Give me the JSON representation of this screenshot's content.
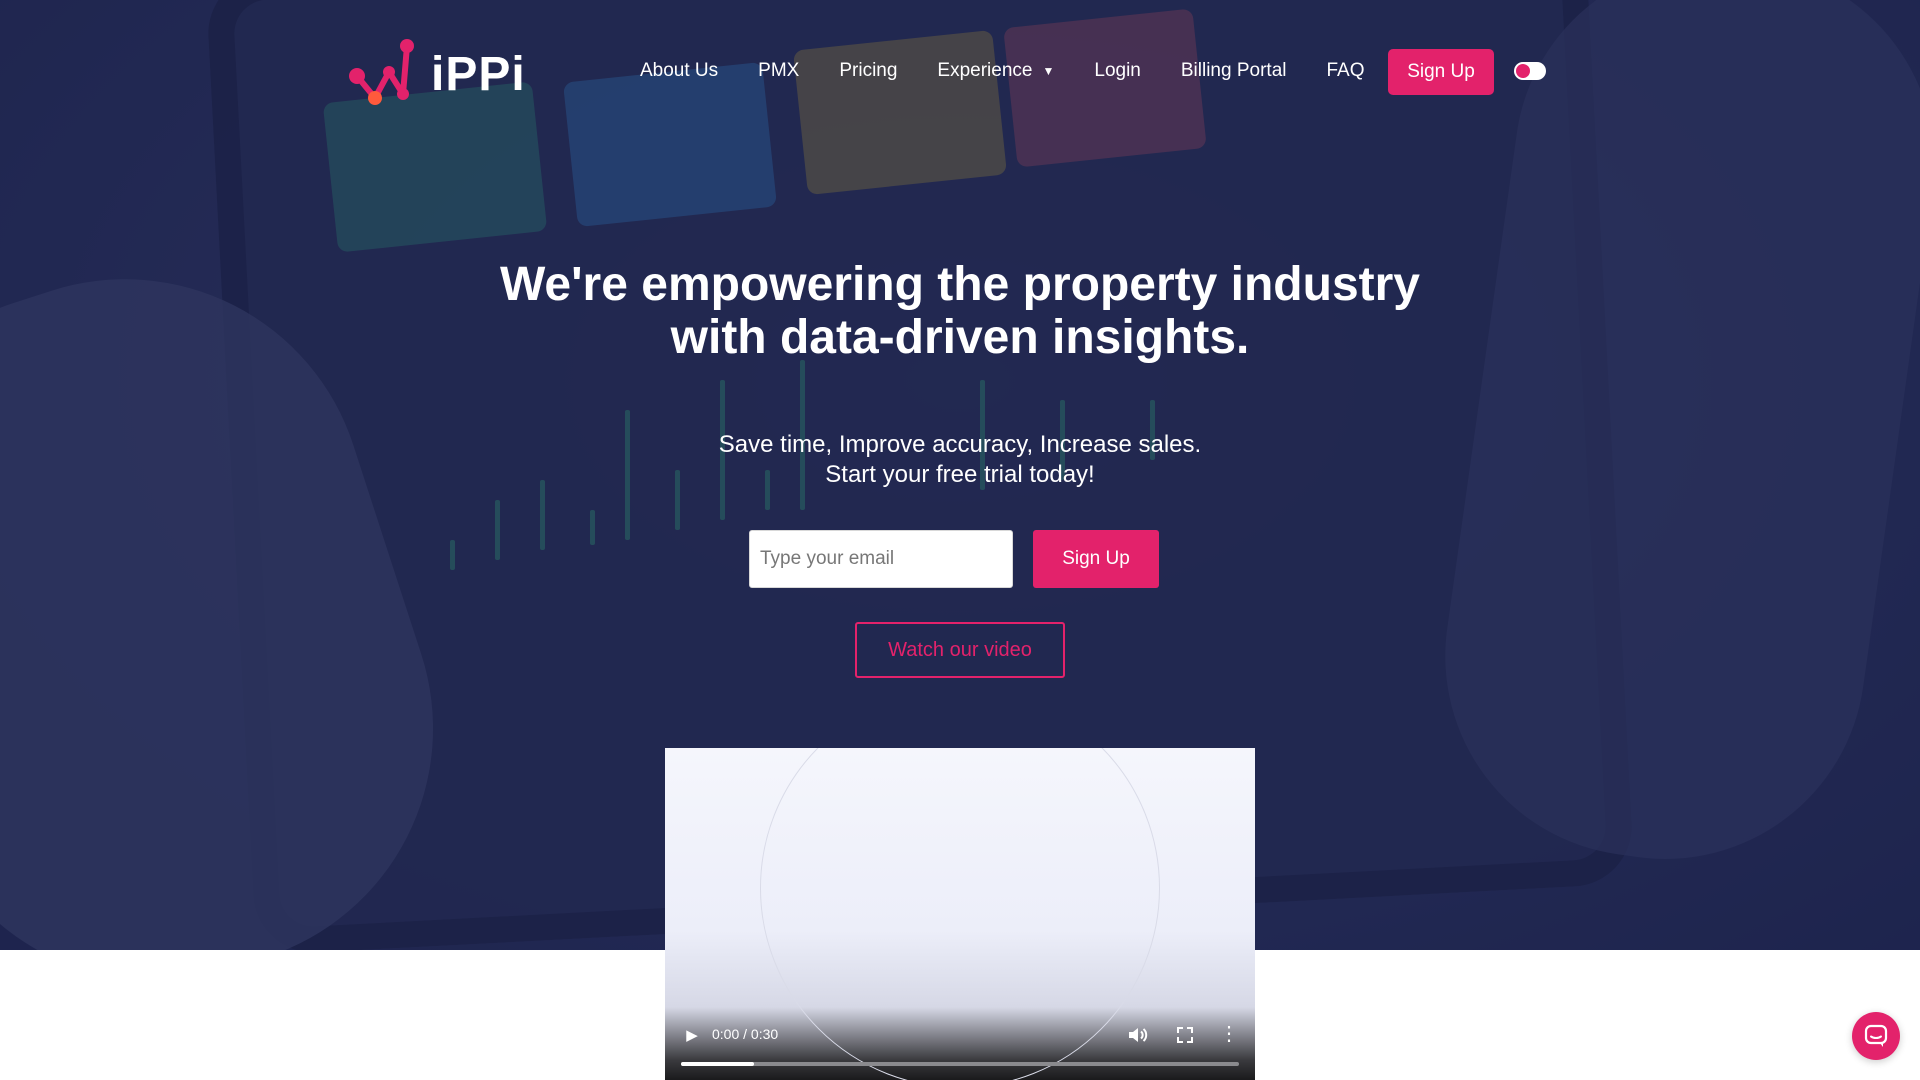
{
  "brand": {
    "name": "iPPi",
    "accent_color": "#e3226b",
    "logo_icon": "network-nodes-logo"
  },
  "nav": {
    "items": [
      {
        "label": "About Us"
      },
      {
        "label": "PMX"
      },
      {
        "label": "Pricing"
      },
      {
        "label": "Experience",
        "has_dropdown": true
      },
      {
        "label": "Login"
      },
      {
        "label": "Billing Portal"
      },
      {
        "label": "FAQ"
      }
    ],
    "signup_label": "Sign Up",
    "theme_toggle_icon": "theme-toggle"
  },
  "hero": {
    "headline_line1": "We're empowering the property industry",
    "headline_line2": "with data-driven insights.",
    "subtext_line1": "Save time, Improve accuracy, Increase sales.",
    "subtext_line2": "Start your free trial today!",
    "email_placeholder": "Type your email",
    "signup_label": "Sign Up",
    "watch_label": "Watch our video"
  },
  "video": {
    "time_display": "0:00 / 0:30",
    "buffered_progress": 0.13
  },
  "chat": {
    "icon": "chat-bubble-icon"
  }
}
